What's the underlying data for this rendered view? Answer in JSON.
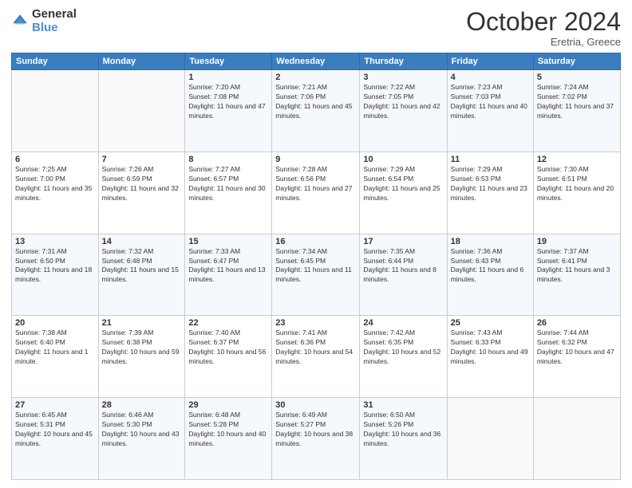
{
  "header": {
    "logo_general": "General",
    "logo_blue": "Blue",
    "month_title": "October 2024",
    "location": "Eretria, Greece"
  },
  "weekdays": [
    "Sunday",
    "Monday",
    "Tuesday",
    "Wednesday",
    "Thursday",
    "Friday",
    "Saturday"
  ],
  "weeks": [
    [
      {
        "day": "",
        "sunrise": "",
        "sunset": "",
        "daylight": ""
      },
      {
        "day": "",
        "sunrise": "",
        "sunset": "",
        "daylight": ""
      },
      {
        "day": "1",
        "sunrise": "Sunrise: 7:20 AM",
        "sunset": "Sunset: 7:08 PM",
        "daylight": "Daylight: 11 hours and 47 minutes."
      },
      {
        "day": "2",
        "sunrise": "Sunrise: 7:21 AM",
        "sunset": "Sunset: 7:06 PM",
        "daylight": "Daylight: 11 hours and 45 minutes."
      },
      {
        "day": "3",
        "sunrise": "Sunrise: 7:22 AM",
        "sunset": "Sunset: 7:05 PM",
        "daylight": "Daylight: 11 hours and 42 minutes."
      },
      {
        "day": "4",
        "sunrise": "Sunrise: 7:23 AM",
        "sunset": "Sunset: 7:03 PM",
        "daylight": "Daylight: 11 hours and 40 minutes."
      },
      {
        "day": "5",
        "sunrise": "Sunrise: 7:24 AM",
        "sunset": "Sunset: 7:02 PM",
        "daylight": "Daylight: 11 hours and 37 minutes."
      }
    ],
    [
      {
        "day": "6",
        "sunrise": "Sunrise: 7:25 AM",
        "sunset": "Sunset: 7:00 PM",
        "daylight": "Daylight: 11 hours and 35 minutes."
      },
      {
        "day": "7",
        "sunrise": "Sunrise: 7:26 AM",
        "sunset": "Sunset: 6:59 PM",
        "daylight": "Daylight: 11 hours and 32 minutes."
      },
      {
        "day": "8",
        "sunrise": "Sunrise: 7:27 AM",
        "sunset": "Sunset: 6:57 PM",
        "daylight": "Daylight: 11 hours and 30 minutes."
      },
      {
        "day": "9",
        "sunrise": "Sunrise: 7:28 AM",
        "sunset": "Sunset: 6:56 PM",
        "daylight": "Daylight: 11 hours and 27 minutes."
      },
      {
        "day": "10",
        "sunrise": "Sunrise: 7:29 AM",
        "sunset": "Sunset: 6:54 PM",
        "daylight": "Daylight: 11 hours and 25 minutes."
      },
      {
        "day": "11",
        "sunrise": "Sunrise: 7:29 AM",
        "sunset": "Sunset: 6:53 PM",
        "daylight": "Daylight: 11 hours and 23 minutes."
      },
      {
        "day": "12",
        "sunrise": "Sunrise: 7:30 AM",
        "sunset": "Sunset: 6:51 PM",
        "daylight": "Daylight: 11 hours and 20 minutes."
      }
    ],
    [
      {
        "day": "13",
        "sunrise": "Sunrise: 7:31 AM",
        "sunset": "Sunset: 6:50 PM",
        "daylight": "Daylight: 11 hours and 18 minutes."
      },
      {
        "day": "14",
        "sunrise": "Sunrise: 7:32 AM",
        "sunset": "Sunset: 6:48 PM",
        "daylight": "Daylight: 11 hours and 15 minutes."
      },
      {
        "day": "15",
        "sunrise": "Sunrise: 7:33 AM",
        "sunset": "Sunset: 6:47 PM",
        "daylight": "Daylight: 11 hours and 13 minutes."
      },
      {
        "day": "16",
        "sunrise": "Sunrise: 7:34 AM",
        "sunset": "Sunset: 6:45 PM",
        "daylight": "Daylight: 11 hours and 11 minutes."
      },
      {
        "day": "17",
        "sunrise": "Sunrise: 7:35 AM",
        "sunset": "Sunset: 6:44 PM",
        "daylight": "Daylight: 11 hours and 8 minutes."
      },
      {
        "day": "18",
        "sunrise": "Sunrise: 7:36 AM",
        "sunset": "Sunset: 6:43 PM",
        "daylight": "Daylight: 11 hours and 6 minutes."
      },
      {
        "day": "19",
        "sunrise": "Sunrise: 7:37 AM",
        "sunset": "Sunset: 6:41 PM",
        "daylight": "Daylight: 11 hours and 3 minutes."
      }
    ],
    [
      {
        "day": "20",
        "sunrise": "Sunrise: 7:38 AM",
        "sunset": "Sunset: 6:40 PM",
        "daylight": "Daylight: 11 hours and 1 minute."
      },
      {
        "day": "21",
        "sunrise": "Sunrise: 7:39 AM",
        "sunset": "Sunset: 6:38 PM",
        "daylight": "Daylight: 10 hours and 59 minutes."
      },
      {
        "day": "22",
        "sunrise": "Sunrise: 7:40 AM",
        "sunset": "Sunset: 6:37 PM",
        "daylight": "Daylight: 10 hours and 56 minutes."
      },
      {
        "day": "23",
        "sunrise": "Sunrise: 7:41 AM",
        "sunset": "Sunset: 6:36 PM",
        "daylight": "Daylight: 10 hours and 54 minutes."
      },
      {
        "day": "24",
        "sunrise": "Sunrise: 7:42 AM",
        "sunset": "Sunset: 6:35 PM",
        "daylight": "Daylight: 10 hours and 52 minutes."
      },
      {
        "day": "25",
        "sunrise": "Sunrise: 7:43 AM",
        "sunset": "Sunset: 6:33 PM",
        "daylight": "Daylight: 10 hours and 49 minutes."
      },
      {
        "day": "26",
        "sunrise": "Sunrise: 7:44 AM",
        "sunset": "Sunset: 6:32 PM",
        "daylight": "Daylight: 10 hours and 47 minutes."
      }
    ],
    [
      {
        "day": "27",
        "sunrise": "Sunrise: 6:45 AM",
        "sunset": "Sunset: 5:31 PM",
        "daylight": "Daylight: 10 hours and 45 minutes."
      },
      {
        "day": "28",
        "sunrise": "Sunrise: 6:46 AM",
        "sunset": "Sunset: 5:30 PM",
        "daylight": "Daylight: 10 hours and 43 minutes."
      },
      {
        "day": "29",
        "sunrise": "Sunrise: 6:48 AM",
        "sunset": "Sunset: 5:28 PM",
        "daylight": "Daylight: 10 hours and 40 minutes."
      },
      {
        "day": "30",
        "sunrise": "Sunrise: 6:49 AM",
        "sunset": "Sunset: 5:27 PM",
        "daylight": "Daylight: 10 hours and 38 minutes."
      },
      {
        "day": "31",
        "sunrise": "Sunrise: 6:50 AM",
        "sunset": "Sunset: 5:26 PM",
        "daylight": "Daylight: 10 hours and 36 minutes."
      },
      {
        "day": "",
        "sunrise": "",
        "sunset": "",
        "daylight": ""
      },
      {
        "day": "",
        "sunrise": "",
        "sunset": "",
        "daylight": ""
      }
    ]
  ]
}
